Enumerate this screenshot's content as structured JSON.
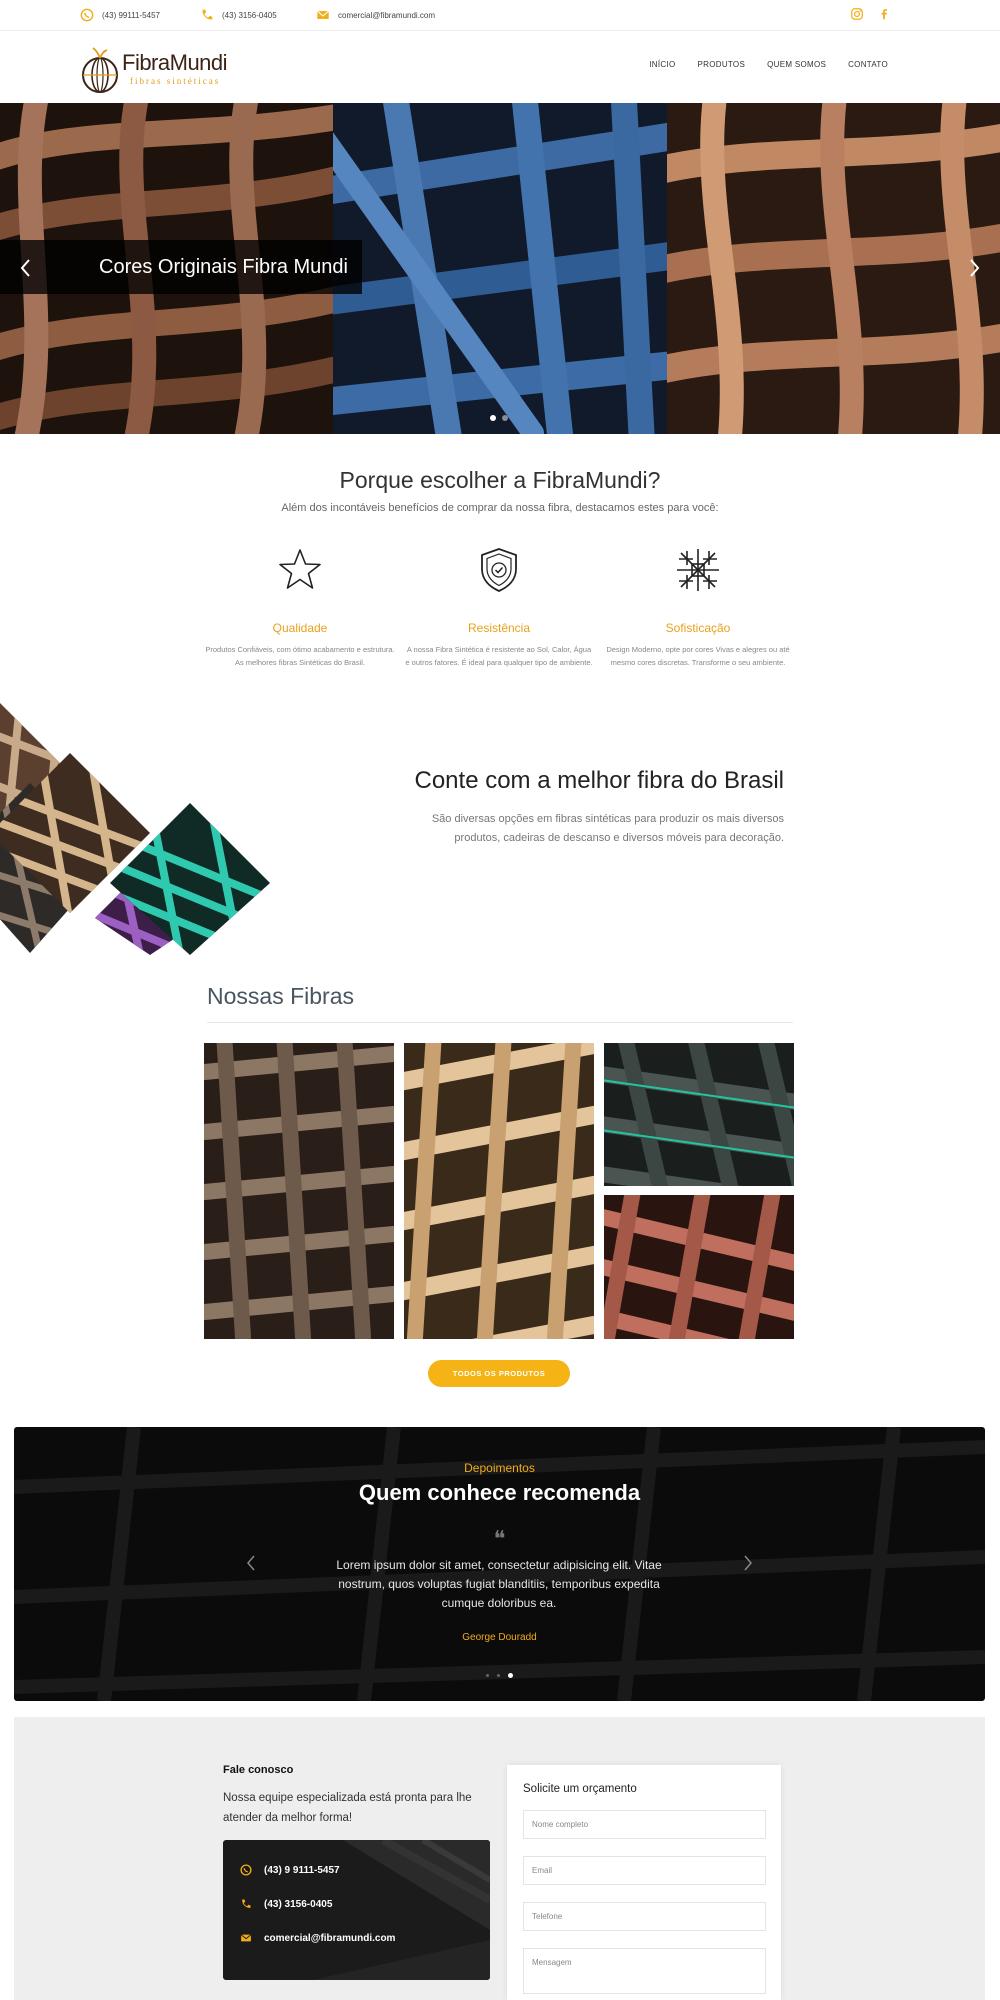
{
  "topbar": {
    "phone_whatsapp": "(43) 99111-5457",
    "phone": "(43) 3156-0405",
    "email": "comercial@fibramundi.com"
  },
  "header": {
    "logo_name": "FibraMundi",
    "logo_tagline": "fibras sintéticas",
    "nav": [
      "INÍCIO",
      "PRODUTOS",
      "QUEM SOMOS",
      "CONTATO"
    ]
  },
  "hero": {
    "caption": "Cores Originais Fibra Mundi"
  },
  "why": {
    "title": "Porque escolher a FibraMundi?",
    "subtitle": "Além dos incontáveis benefícios de comprar da nossa fibra, destacamos estes para você:",
    "features": [
      {
        "icon": "star-icon",
        "title": "Qualidade",
        "text": "Produtos Confiáveis, com ótimo acabamento e estrutura. As melhores fibras Sintéticas do Brasil."
      },
      {
        "icon": "shield-check-icon",
        "title": "Resistência",
        "text": "A nossa Fibra Sintética é resistente ao Sol, Calor, Água e outros fatores. É ideal para qualquer tipo de ambiente."
      },
      {
        "icon": "pattern-icon",
        "title": "Sofisticação",
        "text": "Design Moderno, opte por cores Vivas e alegres ou até mesmo cores discretas. Transforme o seu ambiente."
      }
    ]
  },
  "conte": {
    "title": "Conte com a melhor fibra do Brasil",
    "text": "São diversas opções em fibras sintéticas para produzir os mais diversos produtos, cadeiras de descanso e diversos móveis para decoração."
  },
  "fibras": {
    "title": "Nossas Fibras",
    "button": "TODOS OS PRODUTOS"
  },
  "testimonials": {
    "label": "Depoimentos",
    "title": "Quem conhece recomenda",
    "quote_mark": "❝",
    "text": "Lorem ipsum dolor sit amet, consectetur adipisicing elit. Vitae nostrum, quos voluptas fugiat blanditiis, temporibus expedita cumque doloribus ea.",
    "author": "George Douradd"
  },
  "contact": {
    "title": "Fale conosco",
    "text": "Nossa equipe especializada está pronta para lhe atender da melhor forma!",
    "whatsapp": "(43) 9 9111-5457",
    "phone": "(43) 3156-0405",
    "email": "comercial@fibramundi.com",
    "form_title": "Solicite um orçamento",
    "fields": [
      "Nome completo",
      "Email",
      "Telefone",
      "Mensagem"
    ]
  },
  "colors": {
    "accent": "#f5b315",
    "dark": "#0b0b0b"
  }
}
